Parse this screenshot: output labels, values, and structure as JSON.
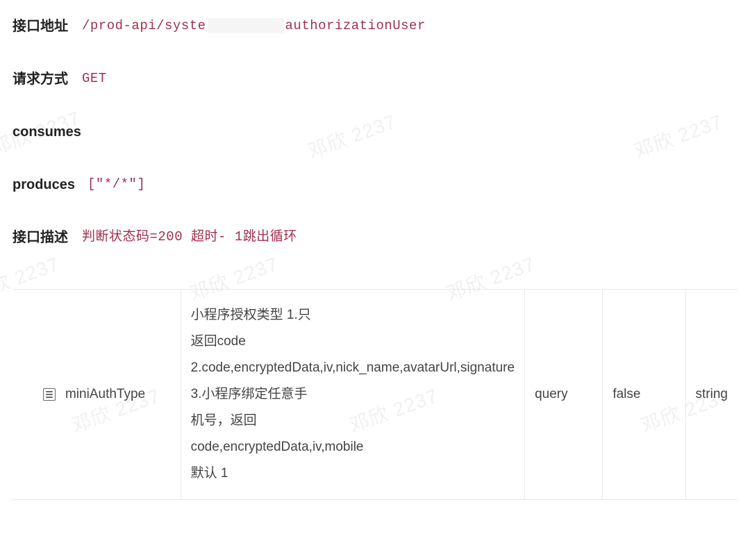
{
  "watermark": "邓欣 2237",
  "fields": {
    "endpoint": {
      "label": "接口地址",
      "value_prefix": "/prod-api/syste",
      "value_suffix": "authorizationUser"
    },
    "method": {
      "label": "请求方式",
      "value": "GET"
    },
    "consumes": {
      "label": "consumes",
      "value": ""
    },
    "produces": {
      "label": "produces",
      "value": "[\"*/*\"]"
    },
    "desc": {
      "label": "接口描述",
      "value": "判断状态码=200 超时- 1跳出循环"
    }
  },
  "param": {
    "name": "miniAuthType",
    "desc_line1": "小程序授权类型 1.只",
    "desc_line2": "返回code",
    "desc_line3": "2.code,encryptedData,iv,nick_name,avatarUrl,signature",
    "desc_line4": "3.小程序绑定任意手",
    "desc_line5": "机号，返回",
    "desc_line6": "code,encryptedData,iv,mobile",
    "desc_line7": "默认 1",
    "in": "query",
    "required": "false",
    "type": "string"
  }
}
